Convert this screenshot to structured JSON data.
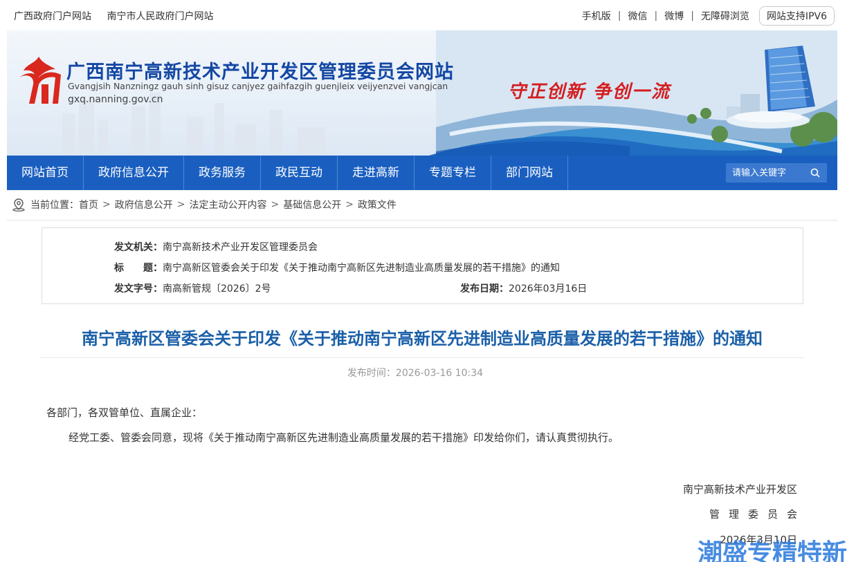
{
  "topbar": {
    "links_left": [
      "广西政府门户网站",
      "南宁市人民政府门户网站"
    ],
    "links_right": [
      "手机版",
      "微信",
      "微博",
      "无障碍浏览"
    ],
    "separator": "|",
    "ipv6": "网站支持IPV6"
  },
  "banner": {
    "title": "广西南宁高新技术产业开发区管理委员会网站",
    "subtitle": "Gvangjsih Nanzningz gauh sinh gisuz canjyez gaihfazgih guenjleix veijyenzvei vangjcan",
    "url": "gxq.nanning.gov.cn",
    "slogan": "守正创新  争创一流"
  },
  "nav": {
    "items": [
      "网站首页",
      "政府信息公开",
      "政务服务",
      "政民互动",
      "走进高新",
      "专题专栏",
      "部门网站"
    ],
    "search_placeholder": "请输入关键字"
  },
  "breadcrumb": {
    "prefix": "当前位置：",
    "items": [
      "首页",
      "政府信息公开",
      "法定主动公开内容",
      "基础信息公开",
      "政策文件"
    ],
    "separator": ">"
  },
  "meta": {
    "issuer_label": "发文机关：",
    "issuer": "南宁高新技术产业开发区管理委员会",
    "title_label": "标　　题：",
    "title": "南宁高新区管委会关于印发《关于推动南宁高新区先进制造业高质量发展的若干措施》的通知",
    "docno_label": "发文字号：",
    "docno": "南高新管规〔2026〕2号",
    "date_label": "发布日期：",
    "date": "2026年03月16日"
  },
  "article": {
    "title": "南宁高新区管委会关于印发《关于推动南宁高新区先进制造业高质量发展的若干措施》的通知",
    "pubtime": "发布时间：2026-03-16 10:34",
    "salutation": "各部门，各双管单位、直属企业：",
    "paragraph": "经党工委、管委会同意，现将《关于推动南宁高新区先进制造业高质量发展的若干措施》印发给你们，请认真贯彻执行。",
    "sign_org_line1": "南宁高新技术产业开发区",
    "sign_org_line2": "管理委员会",
    "sign_date": "2026年3月10日"
  },
  "watermark": "潮盛专精特新",
  "colors": {
    "nav_bg": "#1a5fc0",
    "title_blue": "#1a5fa8",
    "slogan_red": "#d41e1e"
  }
}
